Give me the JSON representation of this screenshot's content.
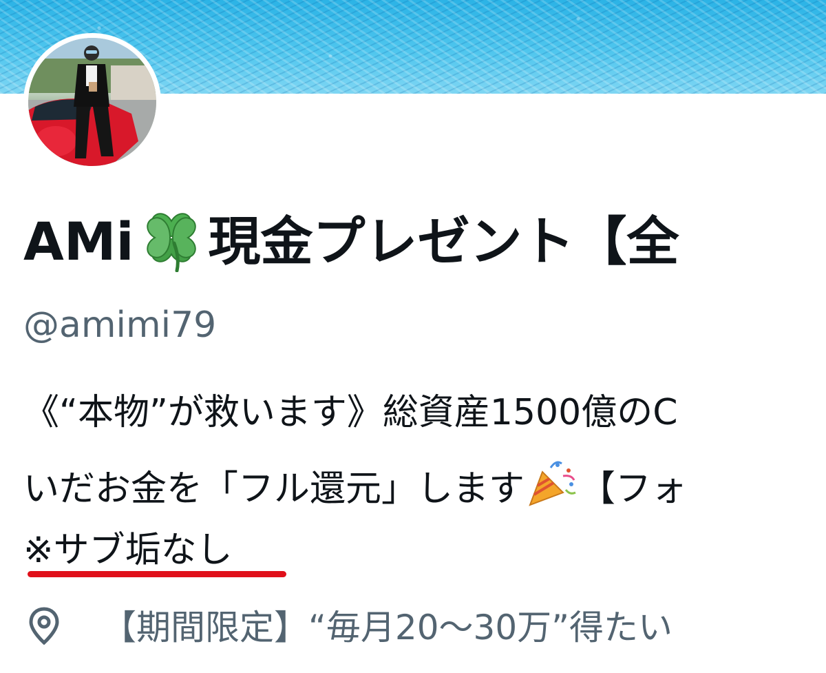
{
  "profile": {
    "display_name_part1": "AMi",
    "display_name_part2": "現金プレゼント【全",
    "handle": "@amimi79"
  },
  "bio": {
    "line1": "《“本物”が救います》総資産1500億のC",
    "line2_part1": "いだお金を「フル還元」します",
    "line2_part2": "【フォ",
    "line3": "※サブ垢なし"
  },
  "location": {
    "text": "【期間限定】“毎月20～30万”得たい"
  },
  "colors": {
    "text": "#0f1419",
    "secondary_text": "#536471",
    "underline": "#e0101a"
  },
  "icons": {
    "clover": "four-leaf-clover-icon",
    "party": "party-popper-icon",
    "location": "location-pin-icon"
  }
}
